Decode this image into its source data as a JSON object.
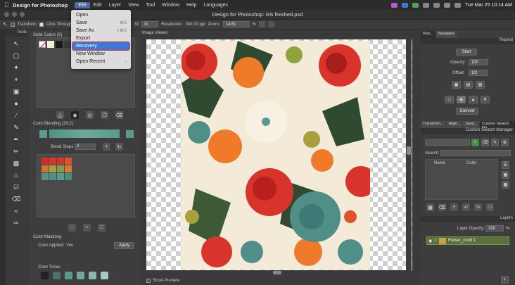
{
  "menubar": {
    "app_name": "Design for Photoshop",
    "menus": [
      "File",
      "Edit",
      "Layer",
      "View",
      "Tool",
      "Window",
      "Help",
      "Languages"
    ],
    "active_menu": "File",
    "clock": "Tue Mar 25  10:14 AM"
  },
  "window": {
    "title": "Design for Photoshop: RS finished.psd"
  },
  "options_bar": {
    "transform_label": "Transform",
    "click_through_label": "Click Through",
    "unit_value": "in",
    "resolution_label": "Resolution:",
    "resolution_value": "300.00 ppi",
    "zoom_label": "Zoom:",
    "zoom_value": "14.61",
    "zoom_unit": "%",
    "fragment": "33"
  },
  "file_menu": {
    "items": [
      {
        "label": "Open",
        "shortcut": ""
      },
      {
        "label": "Save",
        "shortcut": "⌘S"
      },
      {
        "label": "Save As",
        "shortcut": "⇧⌘S"
      },
      {
        "label": "Export",
        "shortcut": ""
      },
      {
        "label": "Recovery",
        "shortcut": ""
      },
      {
        "label": "New Window",
        "shortcut": ""
      },
      {
        "label": "Open Recent",
        "shortcut": "›"
      }
    ],
    "selected": "Recovery"
  },
  "tools": {
    "header": "Tools"
  },
  "left_panel": {
    "solid_colors_title": "Solid Colors (5)",
    "solid_swatches": [
      "#f4ecd8",
      "#1a1a1a",
      "#3a3a3a",
      "#4a4a4a"
    ],
    "color_blending_title": "Color Blending (3/12)",
    "blend_steps_label": "Blend Steps",
    "blend_steps_value": "2",
    "blend_grid": [
      "#d22b2b",
      "#d8342a",
      "#c93a2b",
      "#e0502a",
      "#c97a2a",
      "#a8a03a",
      "#8a9a4a",
      "#d67a3a",
      "#5a8f8a",
      "#4f8f88",
      "#5a9a8e",
      "#4a8a80"
    ],
    "color_matching_title": "Color Matching",
    "color_applied_label": "Color Applied:",
    "color_applied_value": "Yes",
    "apply_label": "Apply",
    "color_tones_title": "Color Tones"
  },
  "viewer": {
    "header": "Image Viewer",
    "show_preview_label": "Show Preview"
  },
  "right_panel": {
    "top_tabs": [
      "Rep...",
      "Navigator"
    ],
    "repeat_label": "Repeat",
    "start_label": "Start",
    "opacity_label": "Opacity:",
    "opacity_value": "100",
    "offset_label": "Offset:",
    "offset_value": "1/2",
    "convert_label": "Convert",
    "mid_tabs": [
      "Transform...",
      "Align...",
      "Swat...",
      "Custom Swatch Ma..."
    ],
    "swatch_manager_label": "Custom Swatch Manager",
    "search_label": "Search:",
    "col_name": "Name",
    "col_color": "Color",
    "layers_label": "Layers",
    "layer_opacity_label": "Layer Opacity:",
    "layer_opacity_value": "100",
    "layer_opacity_unit": "%",
    "layer_name": "Flower_motif 1"
  },
  "colors": {
    "accent": "#3b78d8",
    "selection_outline": "#e0302a",
    "panel": "#3d3d3d",
    "teal": "#5a9a8e"
  }
}
